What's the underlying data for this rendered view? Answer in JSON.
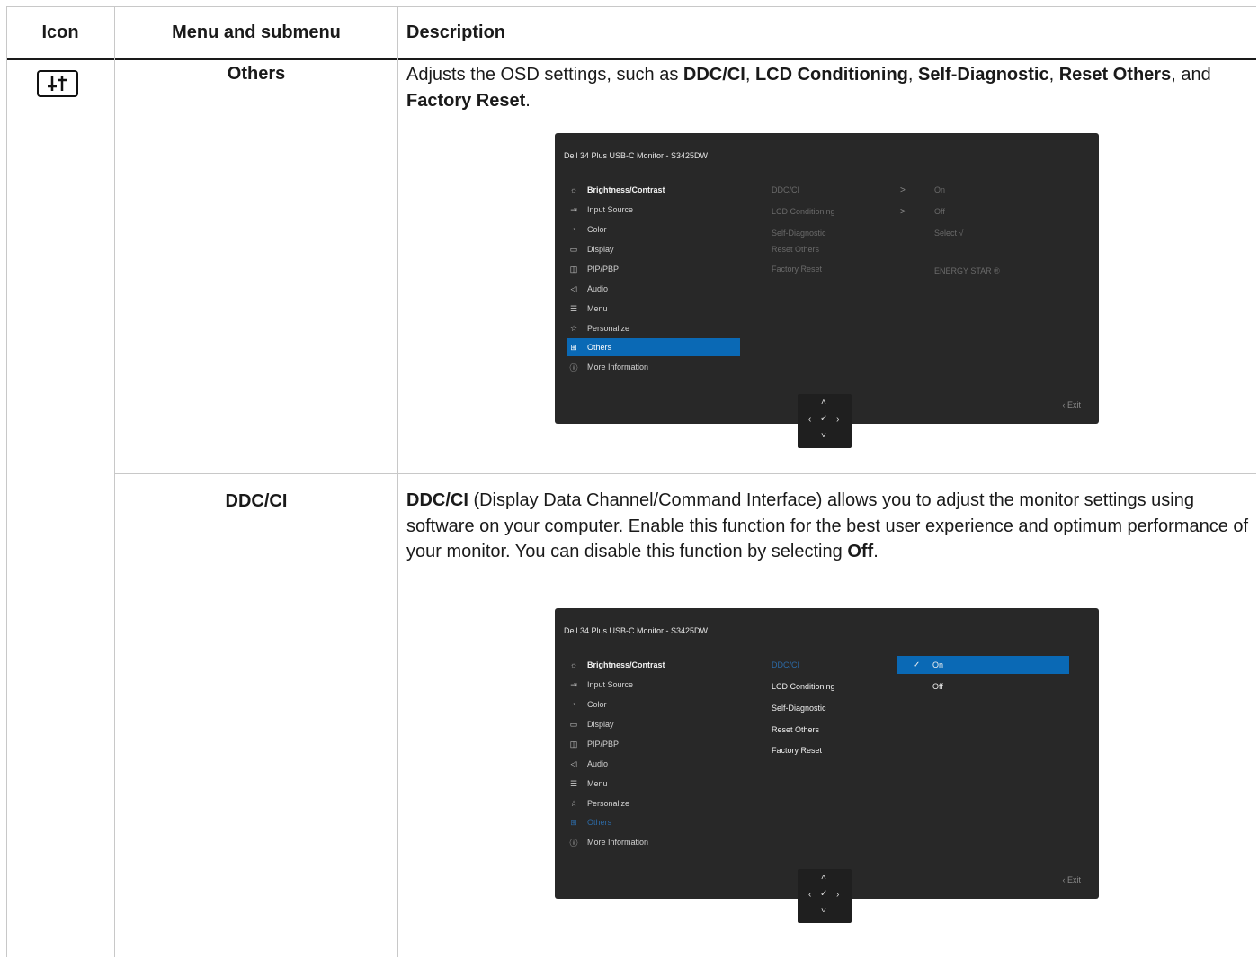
{
  "table": {
    "headers": [
      "Icon",
      "Menu and submenu",
      "Description"
    ],
    "rows": [
      {
        "icon": "others-sliders-icon",
        "menu": "Others",
        "desc": {
          "t1": "Adjusts the OSD settings, such as ",
          "b1": "DDC/CI",
          "t2": ", ",
          "b2": "LCD Conditioning",
          "t3": ", ",
          "b3": "Self-Diagnostic",
          "t4": ", ",
          "b4": "Reset Others",
          "t5": ", and ",
          "b5": "Factory Reset",
          "t6": "."
        }
      },
      {
        "menu": "DDC/CI",
        "desc": {
          "b1": "DDC/CI",
          "t1": " (Display Data Channel/Command Interface) allows you to adjust the monitor settings using software on your computer. Enable this function for the best user experience and optimum performance of your monitor. You can disable this function by selecting ",
          "b2": "Off",
          "t2": "."
        }
      }
    ]
  },
  "osd1": {
    "title": "Dell 34 Plus USB-C Monitor - S3425DW",
    "menu": [
      {
        "icon": "brightness-icon",
        "label": "Brightness/Contrast"
      },
      {
        "icon": "input-source-icon",
        "label": "Input Source"
      },
      {
        "icon": "color-icon",
        "label": "Color"
      },
      {
        "icon": "display-icon",
        "label": "Display"
      },
      {
        "icon": "pip-pbp-icon",
        "label": "PIP/PBP"
      },
      {
        "icon": "audio-icon",
        "label": "Audio"
      },
      {
        "icon": "menu-icon",
        "label": "Menu"
      },
      {
        "icon": "personalize-icon",
        "label": "Personalize"
      },
      {
        "icon": "others-icon",
        "label": "Others"
      },
      {
        "icon": "info-icon",
        "label": "More Information"
      }
    ],
    "selected": "Others",
    "submenu": [
      {
        "label": "DDC/CI",
        "arrow": ">",
        "value": "On"
      },
      {
        "label": "LCD Conditioning",
        "arrow": ">",
        "value": "Off"
      },
      {
        "label": "Self-Diagnostic",
        "arrow": "",
        "value": "Select √"
      },
      {
        "label": "Reset Others",
        "arrow": "",
        "value": ""
      },
      {
        "label": "Factory Reset",
        "arrow": "",
        "value": "ENERGY STAR ®"
      }
    ],
    "exit": "‹  Exit"
  },
  "osd2": {
    "title": "Dell 34 Plus USB-C Monitor - S3425DW",
    "menu": [
      {
        "icon": "brightness-icon",
        "label": "Brightness/Contrast"
      },
      {
        "icon": "input-source-icon",
        "label": "Input Source"
      },
      {
        "icon": "color-icon",
        "label": "Color"
      },
      {
        "icon": "display-icon",
        "label": "Display"
      },
      {
        "icon": "pip-pbp-icon",
        "label": "PIP/PBP"
      },
      {
        "icon": "audio-icon",
        "label": "Audio"
      },
      {
        "icon": "menu-icon",
        "label": "Menu"
      },
      {
        "icon": "personalize-icon",
        "label": "Personalize"
      },
      {
        "icon": "others-icon",
        "label": "Others"
      },
      {
        "icon": "info-icon",
        "label": "More Information"
      }
    ],
    "submenu": [
      "DDC/CI",
      "LCD Conditioning",
      "Self-Diagnostic",
      "Reset Others",
      "Factory Reset"
    ],
    "options": [
      {
        "check": "✓",
        "label": "On",
        "selected": true
      },
      {
        "check": "",
        "label": "Off",
        "selected": false
      }
    ],
    "exit": "‹  Exit"
  },
  "joystick": {
    "up": "˄",
    "down": "˅",
    "left": "‹",
    "right": "›",
    "center": "✓"
  }
}
